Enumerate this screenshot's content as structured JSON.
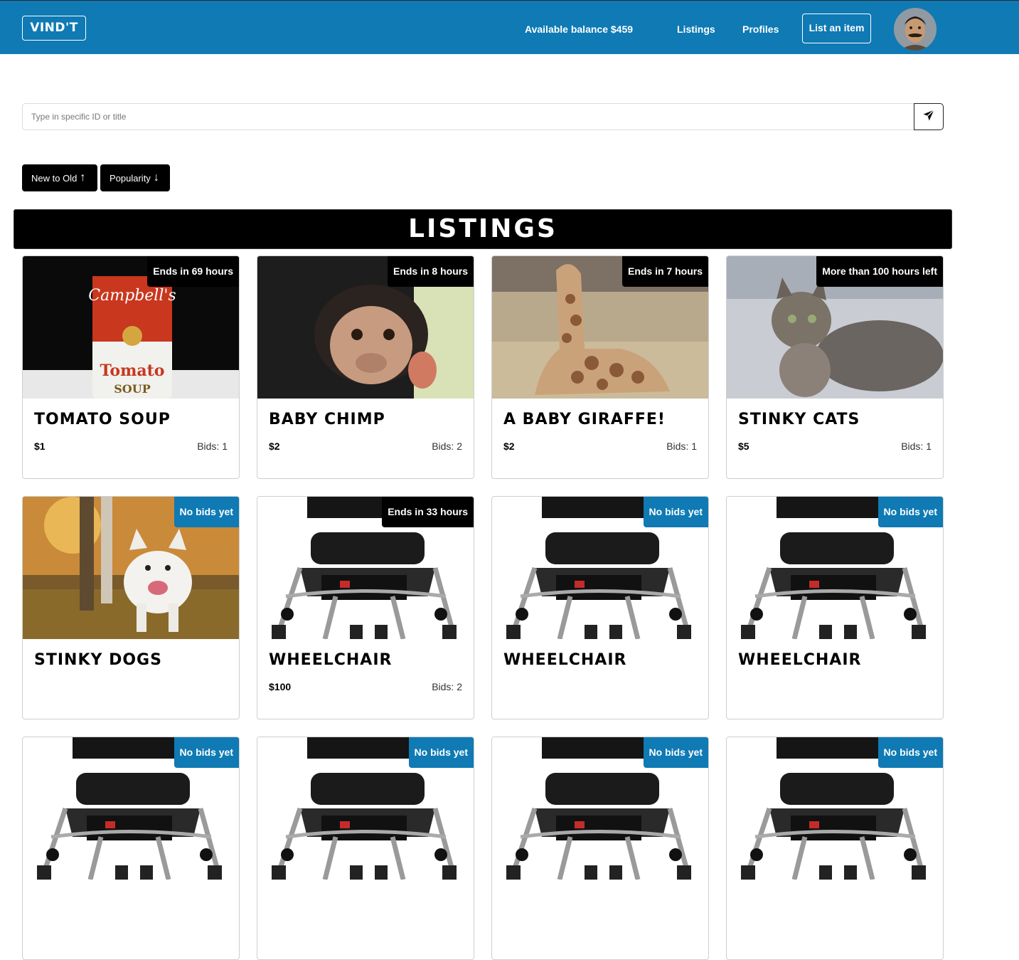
{
  "navbar": {
    "logo": "VIND'T",
    "balance": "Available balance $459",
    "listings_link": "Listings",
    "profiles_link": "Profiles",
    "list_item_button": "List an item"
  },
  "search": {
    "placeholder": "Type in specific ID or title"
  },
  "sort": {
    "new_to_old": "New to Old",
    "popularity": "Popularity"
  },
  "listings_header": "LISTINGS",
  "cards": [
    {
      "title": "TOMATO SOUP",
      "price": "$1",
      "bids": "Bids: 1",
      "badge": "Ends in 69 hours",
      "badge_color": "black",
      "image": "tomato-soup-can"
    },
    {
      "title": "BABY CHIMP",
      "price": "$2",
      "bids": "Bids: 2",
      "badge": "Ends in 8 hours",
      "badge_color": "black",
      "image": "baby-chimp"
    },
    {
      "title": "A BABY GIRAFFE!",
      "price": "$2",
      "bids": "Bids: 1",
      "badge": "Ends in 7 hours",
      "badge_color": "black",
      "image": "baby-giraffe"
    },
    {
      "title": "STINKY CATS",
      "price": "$5",
      "bids": "Bids: 1",
      "badge": "More than 100 hours left",
      "badge_color": "black",
      "image": "tabby-cat"
    },
    {
      "title": "STINKY DOGS",
      "price": "",
      "bids": "",
      "badge": "No bids yet",
      "badge_color": "blue",
      "image": "white-dog"
    },
    {
      "title": "WHEELCHAIR",
      "price": "$100",
      "bids": "Bids: 2",
      "badge": "Ends in 33 hours",
      "badge_color": "black",
      "image": "wheelchair"
    },
    {
      "title": "WHEELCHAIR",
      "price": "",
      "bids": "",
      "badge": "No bids yet",
      "badge_color": "blue",
      "image": "wheelchair"
    },
    {
      "title": "WHEELCHAIR",
      "price": "",
      "bids": "",
      "badge": "No bids yet",
      "badge_color": "blue",
      "image": "wheelchair"
    },
    {
      "title": "",
      "price": "",
      "bids": "",
      "badge": "No bids yet",
      "badge_color": "blue",
      "image": "wheelchair"
    },
    {
      "title": "",
      "price": "",
      "bids": "",
      "badge": "No bids yet",
      "badge_color": "blue",
      "image": "wheelchair"
    },
    {
      "title": "",
      "price": "",
      "bids": "",
      "badge": "No bids yet",
      "badge_color": "blue",
      "image": "wheelchair"
    },
    {
      "title": "",
      "price": "",
      "bids": "",
      "badge": "No bids yet",
      "badge_color": "blue",
      "image": "wheelchair"
    }
  ],
  "colors": {
    "brand_blue": "#0f7ab4",
    "black": "#000000"
  }
}
